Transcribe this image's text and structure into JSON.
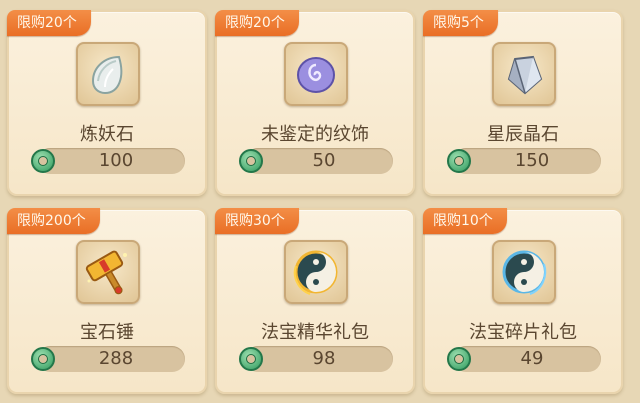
{
  "items": [
    {
      "limit": "限购20个",
      "name": "炼妖石",
      "price": "100",
      "icon": "leaf-gem-icon"
    },
    {
      "limit": "限购20个",
      "name": "未鉴定的纹饰",
      "price": "50",
      "icon": "purple-swirl-stone-icon"
    },
    {
      "limit": "限购5个",
      "name": "星辰晶石",
      "price": "150",
      "icon": "crystal-icon"
    },
    {
      "limit": "限购200个",
      "name": "宝石锤",
      "price": "288",
      "icon": "golden-hammer-icon"
    },
    {
      "limit": "限购30个",
      "name": "法宝精华礼包",
      "price": "98",
      "icon": "yin-yang-gold-icon"
    },
    {
      "limit": "限购10个",
      "name": "法宝碎片礼包",
      "price": "49",
      "icon": "yin-yang-blue-icon"
    }
  ],
  "currency": {
    "icon": "jade-coin-icon"
  },
  "colors": {
    "card_bg": "#f8ead0",
    "tag_bg": "#ee7b33",
    "text": "#5a4630",
    "coin": "#2f9a5d"
  }
}
